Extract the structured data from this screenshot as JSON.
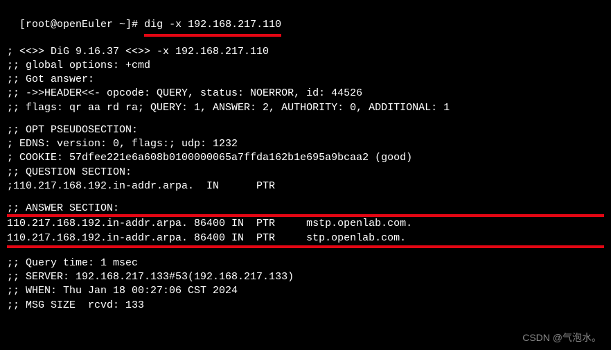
{
  "prompt": {
    "user_host": "[root@openEuler ~]#",
    "command": "dig -x 192.168.217.110"
  },
  "header": {
    "version_line": "; <<>> DiG 9.16.37 <<>> -x 192.168.217.110",
    "global_options": ";; global options: +cmd",
    "got_answer": ";; Got answer:",
    "header_line": ";; ->>HEADER<<- opcode: QUERY, status: NOERROR, id: 44526",
    "flags_line": ";; flags: qr aa rd ra; QUERY: 1, ANSWER: 2, AUTHORITY: 0, ADDITIONAL: 1"
  },
  "opt": {
    "title": ";; OPT PSEUDOSECTION:",
    "edns": "; EDNS: version: 0, flags:; udp: 1232",
    "cookie": "; COOKIE: 57dfee221e6a608b0100000065a7ffda162b1e695a9bcaa2 (good)"
  },
  "question": {
    "title": ";; QUESTION SECTION:",
    "q1": ";110.217.168.192.in-addr.arpa.  IN      PTR"
  },
  "answer": {
    "title": ";; ANSWER SECTION:",
    "a1": "110.217.168.192.in-addr.arpa. 86400 IN  PTR     mstp.openlab.com.",
    "a2": "110.217.168.192.in-addr.arpa. 86400 IN  PTR     stp.openlab.com."
  },
  "footer": {
    "query_time": ";; Query time: 1 msec",
    "server": ";; SERVER: 192.168.217.133#53(192.168.217.133)",
    "when": ";; WHEN: Thu Jan 18 00:27:06 CST 2024",
    "msg_size": ";; MSG SIZE  rcvd: 133"
  },
  "watermark": "CSDN @气泡水。"
}
